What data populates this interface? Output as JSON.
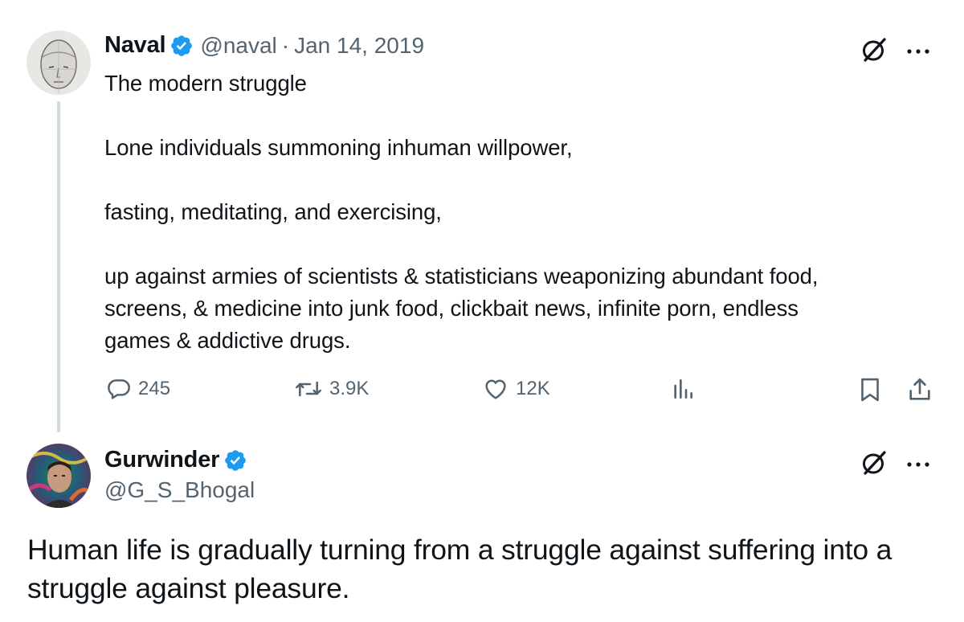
{
  "tweet": {
    "author": {
      "name": "Naval",
      "handle": "@naval",
      "separator": "·",
      "date": "Jan 14, 2019"
    },
    "lines": [
      "The modern struggle",
      "Lone individuals summoning inhuman willpower,",
      "fasting, meditating, and exercising,",
      "up against armies of scientists & statisticians weaponizing abundant food,",
      "screens, & medicine into junk food, clickbait news, infinite porn, endless",
      "games & addictive drugs."
    ],
    "actions": {
      "replies": "245",
      "reposts": "3.9K",
      "likes": "12K"
    }
  },
  "reply": {
    "author": {
      "name": "Gurwinder",
      "handle": "@G_S_Bhogal"
    },
    "lines": [
      "Human life is gradually turning from a struggle against suffering into a",
      "struggle against pleasure."
    ]
  },
  "icons": {
    "verified": "verified-badge-icon",
    "grok": "grok-slash-icon",
    "more": "more-dots-icon",
    "reply": "reply-bubble-icon",
    "repost": "repost-icon",
    "like": "heart-icon",
    "views": "views-bars-icon",
    "bookmark": "bookmark-icon",
    "share": "share-icon"
  },
  "colors": {
    "verified": "#1d9bf0",
    "text": "#0f1419",
    "secondary": "#536471",
    "thread_line": "#cfd9de"
  }
}
